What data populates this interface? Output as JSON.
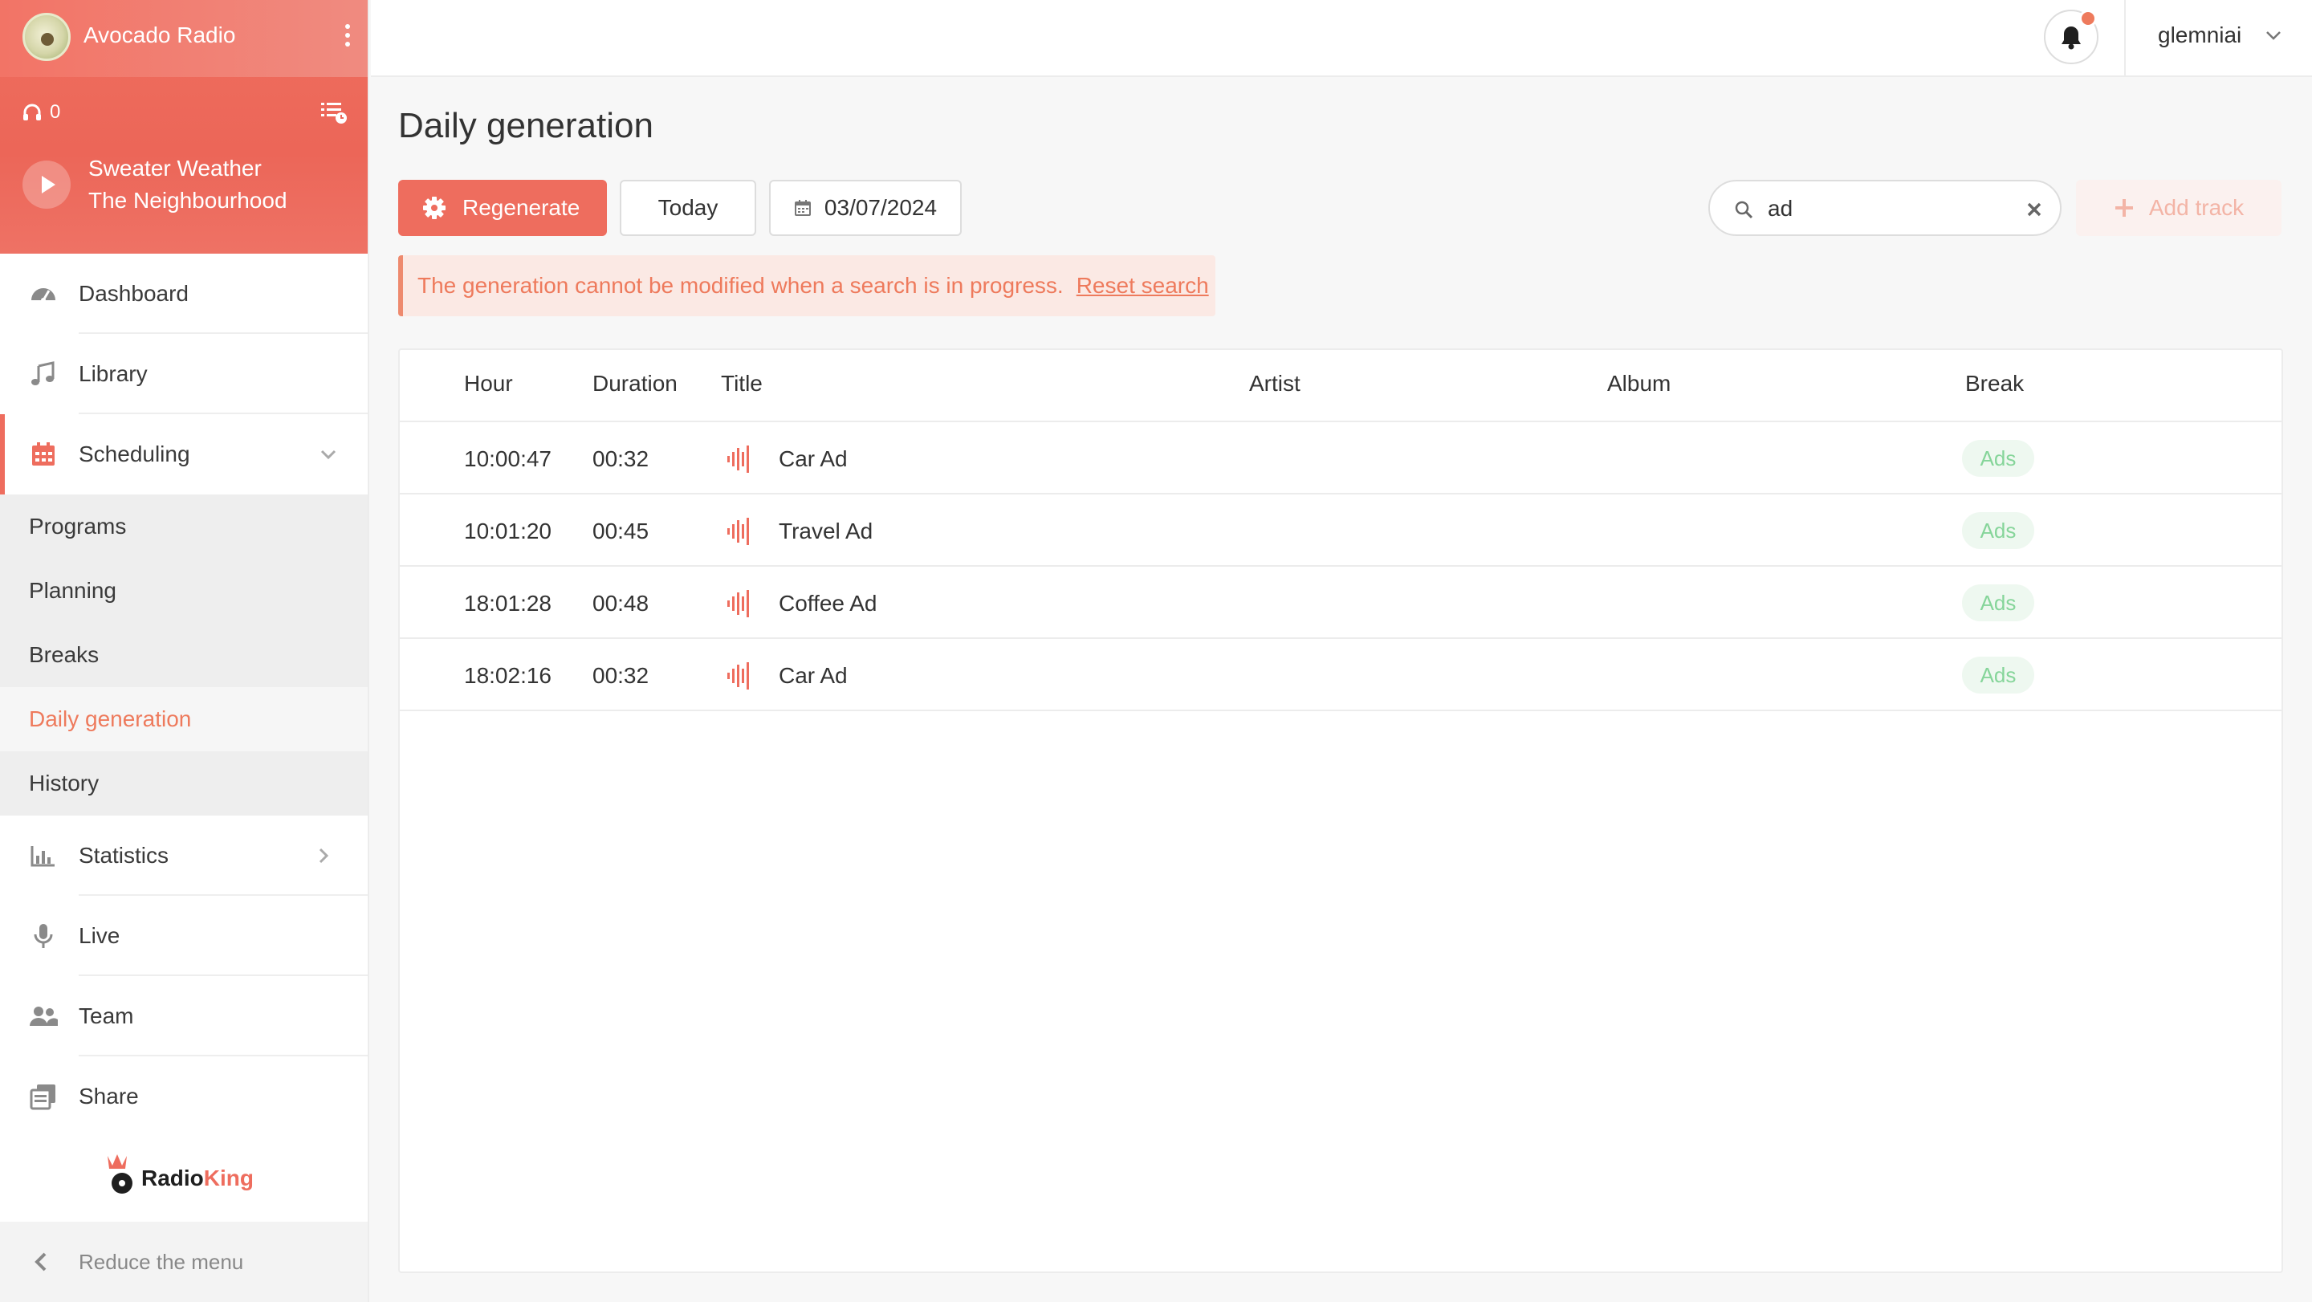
{
  "station": {
    "name": "Avocado Radio",
    "listeners": "0",
    "now_playing": {
      "title": "Sweater Weather",
      "artist": "The Neighbourhood"
    }
  },
  "sidebar": {
    "items": [
      {
        "label": "Dashboard",
        "icon": "gauge-icon"
      },
      {
        "label": "Library",
        "icon": "music-note-icon"
      },
      {
        "label": "Scheduling",
        "icon": "calendar-icon"
      },
      {
        "label": "Statistics",
        "icon": "bar-chart-icon"
      },
      {
        "label": "Live",
        "icon": "microphone-icon"
      },
      {
        "label": "Team",
        "icon": "users-icon"
      },
      {
        "label": "Share",
        "icon": "share-icon"
      }
    ],
    "scheduling_sub": [
      "Programs",
      "Planning",
      "Breaks",
      "Daily generation",
      "History"
    ],
    "brand": {
      "radio": "Radio",
      "king": "King"
    },
    "reduce_label": "Reduce the menu"
  },
  "header": {
    "username": "glemniai"
  },
  "main": {
    "title": "Daily generation",
    "regenerate_label": "Regenerate",
    "today_label": "Today",
    "date": "03/07/2024",
    "search": {
      "value": "ad"
    },
    "add_track_label": "Add track",
    "alert": {
      "message": "The generation cannot be modified when a search is in progress.",
      "link": "Reset search"
    }
  },
  "table": {
    "columns": [
      "Hour",
      "Duration",
      "Title",
      "Artist",
      "Album",
      "Break"
    ],
    "rows": [
      {
        "hour": "10:00:47",
        "duration": "00:32",
        "title": "Car Ad",
        "artist": "",
        "album": "",
        "break": "Ads"
      },
      {
        "hour": "10:01:20",
        "duration": "00:45",
        "title": "Travel Ad",
        "artist": "",
        "album": "",
        "break": "Ads"
      },
      {
        "hour": "18:01:28",
        "duration": "00:48",
        "title": "Coffee Ad",
        "artist": "",
        "album": "",
        "break": "Ads"
      },
      {
        "hour": "18:02:16",
        "duration": "00:32",
        "title": "Car Ad",
        "artist": "",
        "album": "",
        "break": "Ads"
      }
    ]
  },
  "colors": {
    "accent": "#ee6d5e",
    "alert_bg": "#fbe9e4",
    "badge_text": "#86d59a",
    "badge_bg": "#eef8f0"
  }
}
